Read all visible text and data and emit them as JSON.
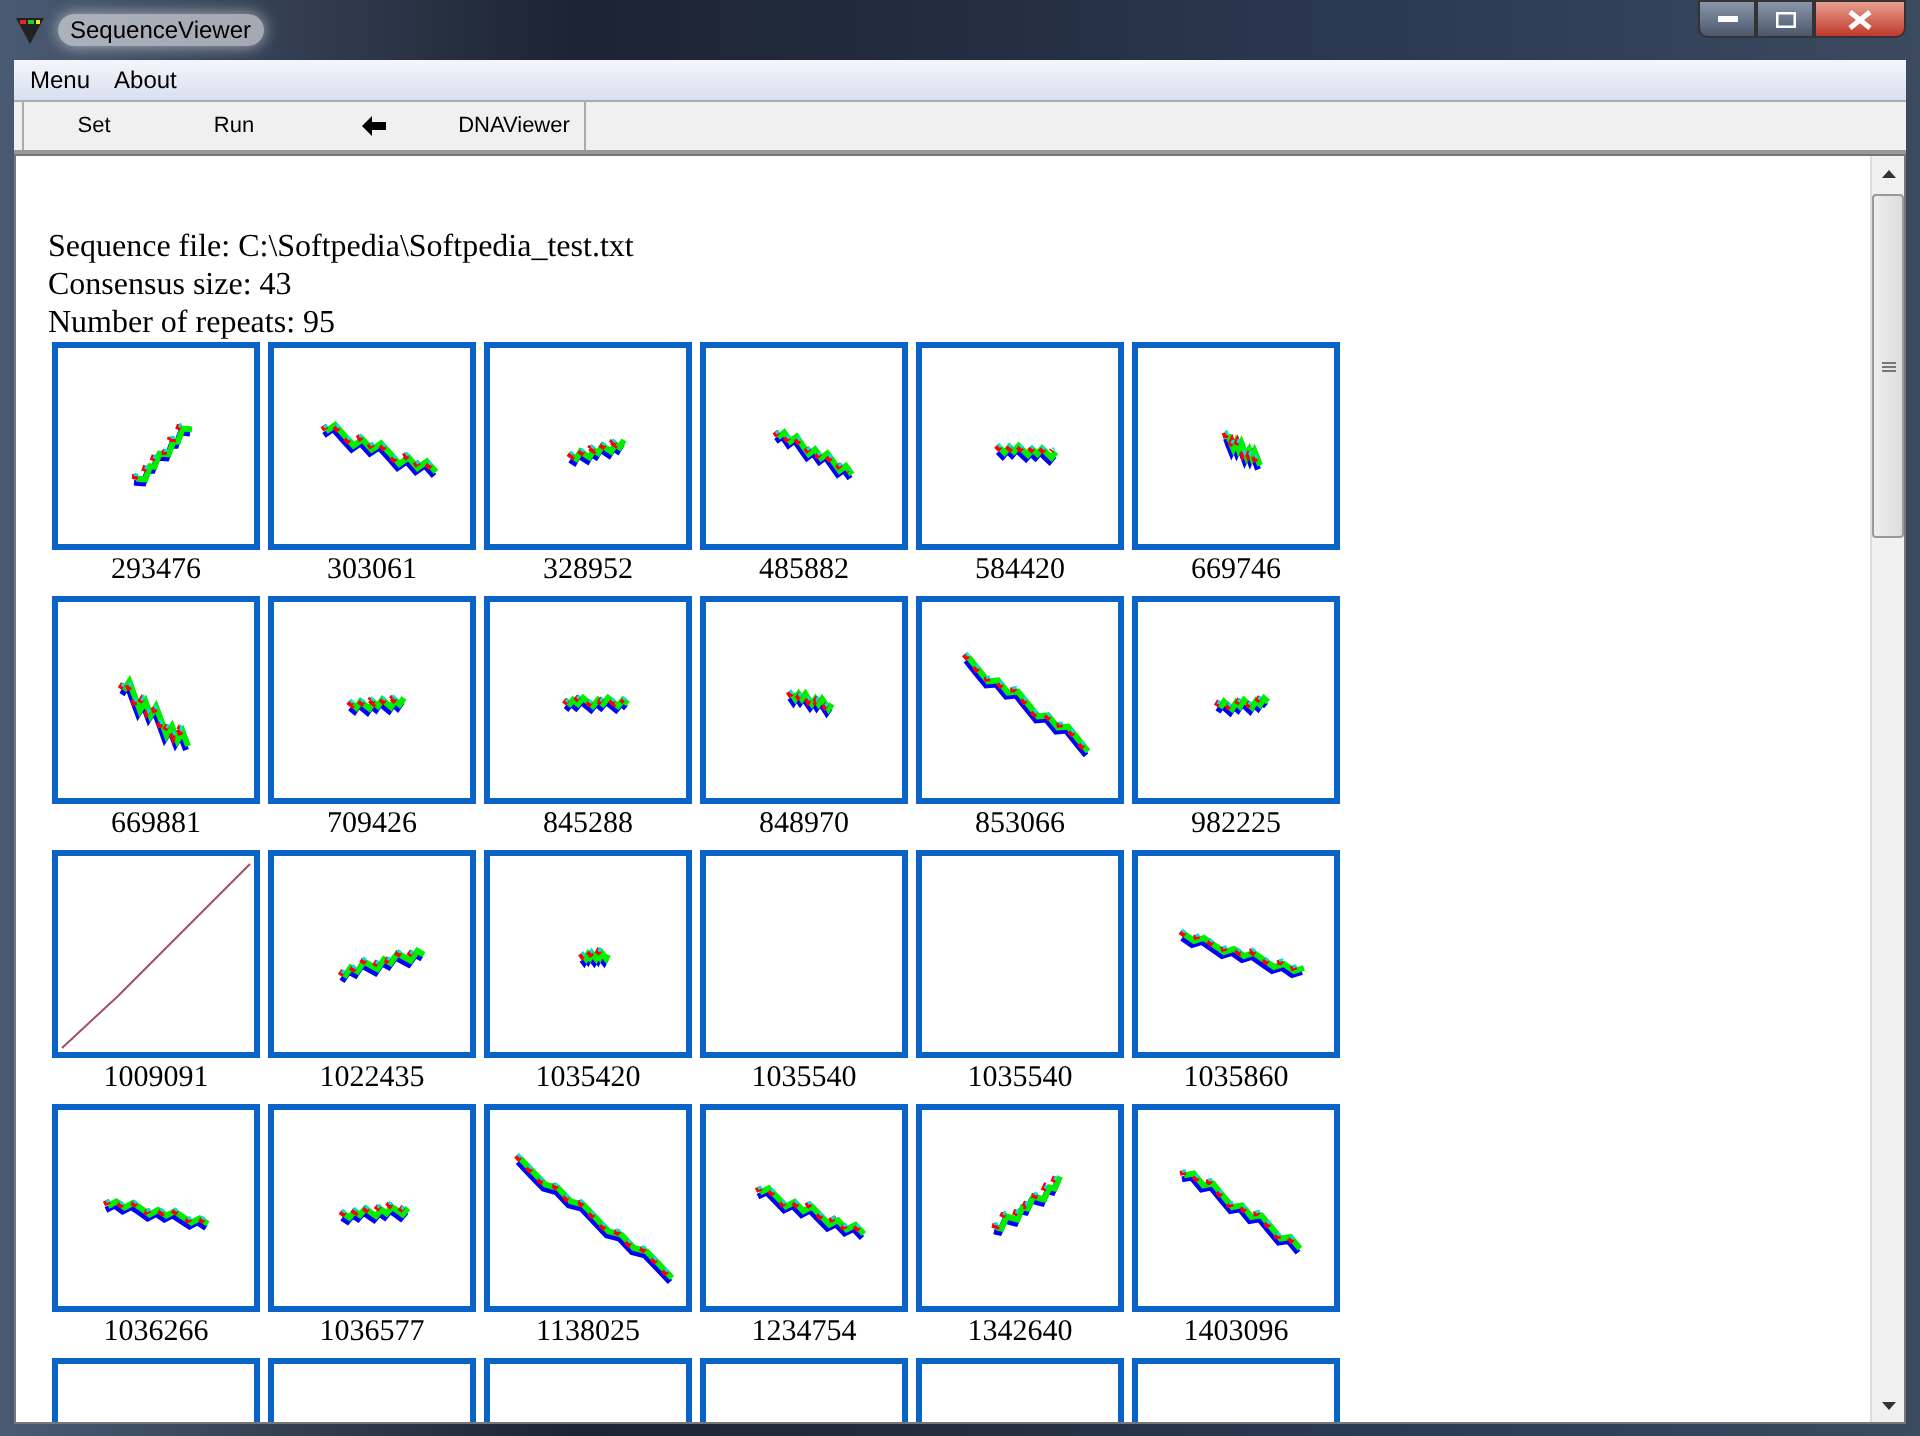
{
  "window": {
    "title": "SequenceViewer"
  },
  "menu": [
    "Menu",
    "About"
  ],
  "toolbar": [
    {
      "kind": "text",
      "label": "Set"
    },
    {
      "kind": "text",
      "label": "Run"
    },
    {
      "kind": "back"
    },
    {
      "kind": "text",
      "label": "DNAViewer"
    }
  ],
  "info": [
    "Sequence file: C:\\Softpedia\\Softpedia_test.txt",
    "Consensus size: 43",
    "Number of repeats: 95"
  ],
  "tiles": [
    {
      "kind": "cluster",
      "label": "293476"
    },
    {
      "kind": "cluster",
      "label": "303061"
    },
    {
      "kind": "cluster",
      "label": "328952"
    },
    {
      "kind": "cluster",
      "label": "485882"
    },
    {
      "kind": "cluster",
      "label": "584420"
    },
    {
      "kind": "cluster",
      "label": "669746"
    },
    {
      "kind": "cluster",
      "label": "669881"
    },
    {
      "kind": "cluster",
      "label": "709426"
    },
    {
      "kind": "cluster",
      "label": "845288"
    },
    {
      "kind": "cluster",
      "label": "848970"
    },
    {
      "kind": "cluster",
      "label": "853066"
    },
    {
      "kind": "cluster",
      "label": "982225"
    },
    {
      "kind": "line",
      "label": "1009091"
    },
    {
      "kind": "cluster",
      "label": "1022435"
    },
    {
      "kind": "cluster",
      "label": "1035420"
    },
    {
      "kind": "empty",
      "label": "1035540"
    },
    {
      "kind": "empty",
      "label": "1035540"
    },
    {
      "kind": "cluster",
      "label": "1035860"
    },
    {
      "kind": "cluster",
      "label": "1036266"
    },
    {
      "kind": "cluster",
      "label": "1036577"
    },
    {
      "kind": "cluster",
      "label": "1138025"
    },
    {
      "kind": "cluster",
      "label": "1234754"
    },
    {
      "kind": "cluster",
      "label": "1342640"
    },
    {
      "kind": "cluster",
      "label": "1403096"
    },
    {
      "kind": "empty"
    },
    {
      "kind": "empty"
    },
    {
      "kind": "empty"
    },
    {
      "kind": "empty"
    },
    {
      "kind": "empty"
    },
    {
      "kind": "empty"
    }
  ]
}
